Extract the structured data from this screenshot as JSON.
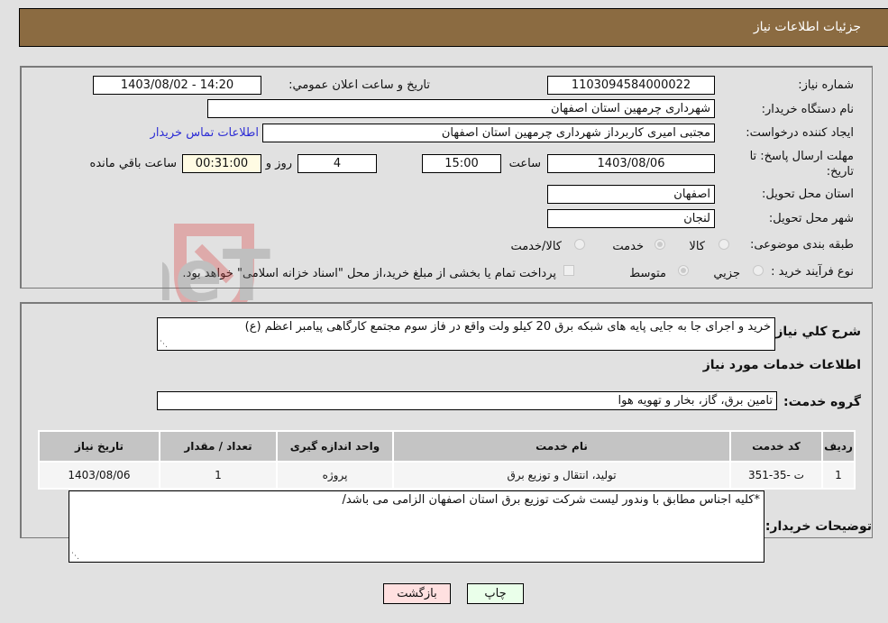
{
  "header": {
    "title": "جزئیات اطلاعات نیاز"
  },
  "details": {
    "need_number_label": "شماره نیاز:",
    "need_number": "1103094584000022",
    "announce_label": "تاريخ و ساعت اعلان عمومي:",
    "announce_value": "1403/08/02 - 14:20",
    "buyer_org_label": "نام دستگاه خريدار:",
    "buyer_org": "شهرداری چرمهین استان اصفهان",
    "creator_label": "ايجاد کننده درخواست:",
    "creator": "مجتبی امیری کاربرداز شهرداری چرمهین استان اصفهان",
    "contact_link": "اطلاعات تماس خريدار",
    "deadline_label": "مهلت ارسال پاسخ: تا تاريخ:",
    "deadline_date": "1403/08/06",
    "time_label": "ساعت",
    "deadline_time": "15:00",
    "days_value": "4",
    "days_label": "روز و",
    "remaining_time": "00:31:00",
    "remaining_label": "ساعت باقي مانده",
    "province_label": "استان محل تحويل:",
    "province": "اصفهان",
    "city_label": "شهر محل تحويل:",
    "city": "لنجان",
    "category_label": "طبقه بندی موضوعی:",
    "category_options": [
      {
        "label": "کالا",
        "checked": false
      },
      {
        "label": "خدمت",
        "checked": true
      },
      {
        "label": "کالا/خدمت",
        "checked": false
      }
    ],
    "process_label": "نوع فرآيند خريد :",
    "process_options": [
      {
        "label": "جزيي",
        "checked": false
      },
      {
        "label": "متوسط",
        "checked": true
      }
    ],
    "treasury_note": "پرداخت تمام يا بخشی از مبلغ خريد،از محل \"اسناد خزانه اسلامی\" خواهد بود."
  },
  "description": {
    "label": "شرح کلي نياز:",
    "value": "خرید و اجرای جا به جایی پایه های شبکه برق 20 کیلو ولت واقع در فاز سوم مجتمع کارگاهی پیامبر اعظم (ع)"
  },
  "services": {
    "section_title": "اطلاعات خدمات مورد نياز",
    "group_label": "گروه خدمت:",
    "group_value": "تامين برق، گاز، بخار و تهويه هوا",
    "table": {
      "headers": [
        "رديف",
        "کد خدمت",
        "نام خدمت",
        "واحد اندازه گيری",
        "تعداد / مقدار",
        "تاريخ نياز"
      ],
      "rows": [
        [
          "1",
          "ت -35-351",
          "توليد، انتقال و توزيع برق",
          "پروژه",
          "1",
          "1403/08/06"
        ]
      ]
    }
  },
  "buyer_notes": {
    "label": "توضيحات خريدار:",
    "value": "*کلیه اجناس مطابق با وندور لیست شرکت توزیع برق استان اصفهان الزامی می باشد/"
  },
  "buttons": {
    "print": "چاپ",
    "back": "بازگشت"
  },
  "watermark": {
    "text": "AriaTender.neT"
  },
  "colors": {
    "header_bg": "#8b6b41",
    "print_bg": "#eaffea",
    "back_bg": "#ffe0e0",
    "link": "#2d2dd5"
  }
}
